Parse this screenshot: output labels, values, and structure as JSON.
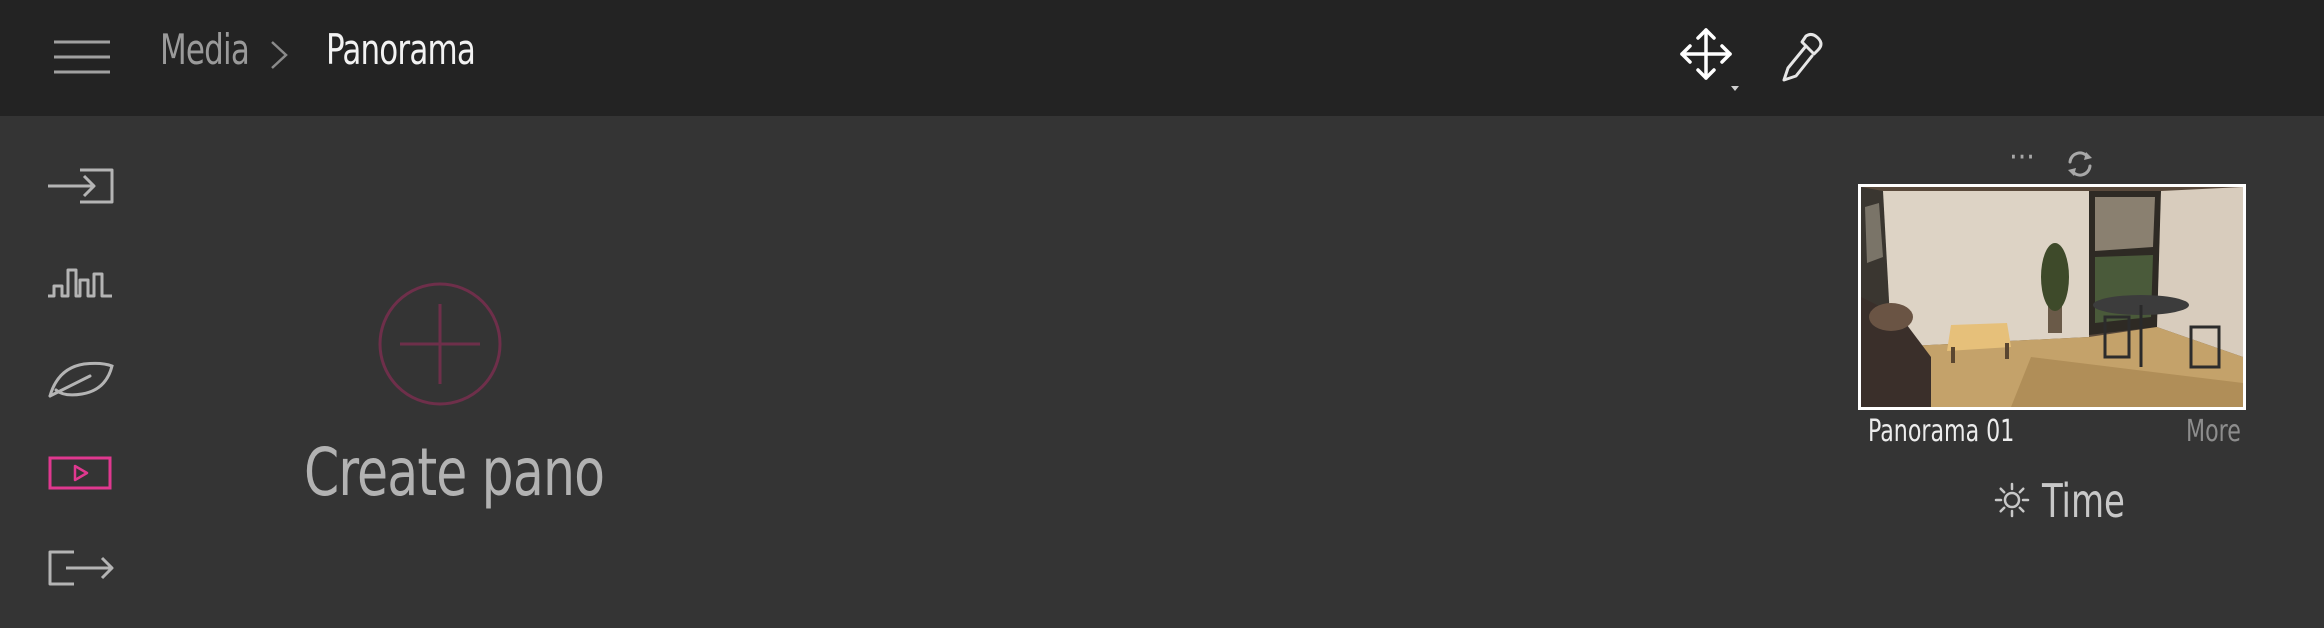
{
  "header": {
    "breadcrumb": {
      "parent": "Media",
      "current": "Panorama"
    },
    "tools": {
      "move": "move-icon",
      "picker": "eyedropper-icon"
    }
  },
  "sidebar": {
    "items": [
      {
        "icon": "import-icon"
      },
      {
        "icon": "skyline-icon"
      },
      {
        "icon": "leaf-icon"
      },
      {
        "icon": "media-icon",
        "active": true
      },
      {
        "icon": "export-icon"
      }
    ]
  },
  "main": {
    "create_label": "Create pano"
  },
  "panel": {
    "dots": "···",
    "item_title": "Panorama 01",
    "more": "More",
    "time_label": "Time"
  },
  "colors": {
    "accent": "#e0388f",
    "create_circle": "#6e2f4a",
    "topbar": "#232323",
    "background": "#343434"
  }
}
